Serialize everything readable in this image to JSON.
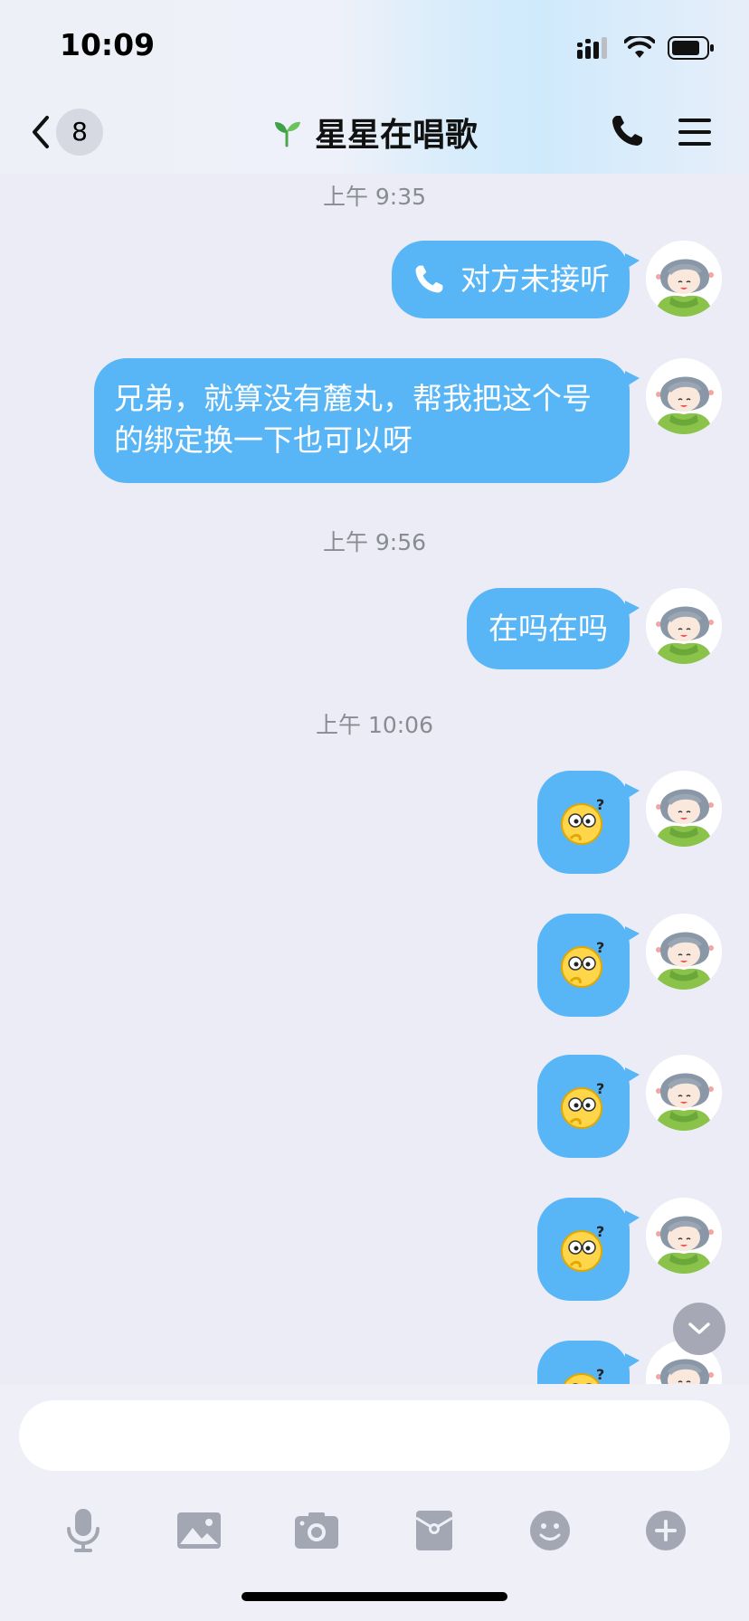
{
  "status_bar": {
    "time": "10:09"
  },
  "nav": {
    "back_count": "8",
    "title": "星星在唱歌"
  },
  "messages": {
    "ts1": "上午 9:35",
    "call_text": "对方未接听",
    "text1": "兄弟，就算没有麓丸，帮我把这个号的绑定换一下也可以呀",
    "ts2": "上午 9:56",
    "text2": "在吗在吗",
    "ts3": "上午 10:06"
  },
  "composer": {
    "placeholder": ""
  },
  "colors": {
    "bubble": "#58b6f6",
    "background": "#ebecf5",
    "icon_gray": "#a3a6b3"
  },
  "icons": [
    "signal-icon",
    "wifi-icon",
    "battery-icon",
    "back-chevron-icon",
    "sprout-icon",
    "phone-icon",
    "menu-icon",
    "thinking-emoji-icon",
    "chevron-down-icon",
    "microphone-icon",
    "image-icon",
    "camera-icon",
    "red-packet-icon",
    "emoji-icon",
    "plus-icon"
  ]
}
